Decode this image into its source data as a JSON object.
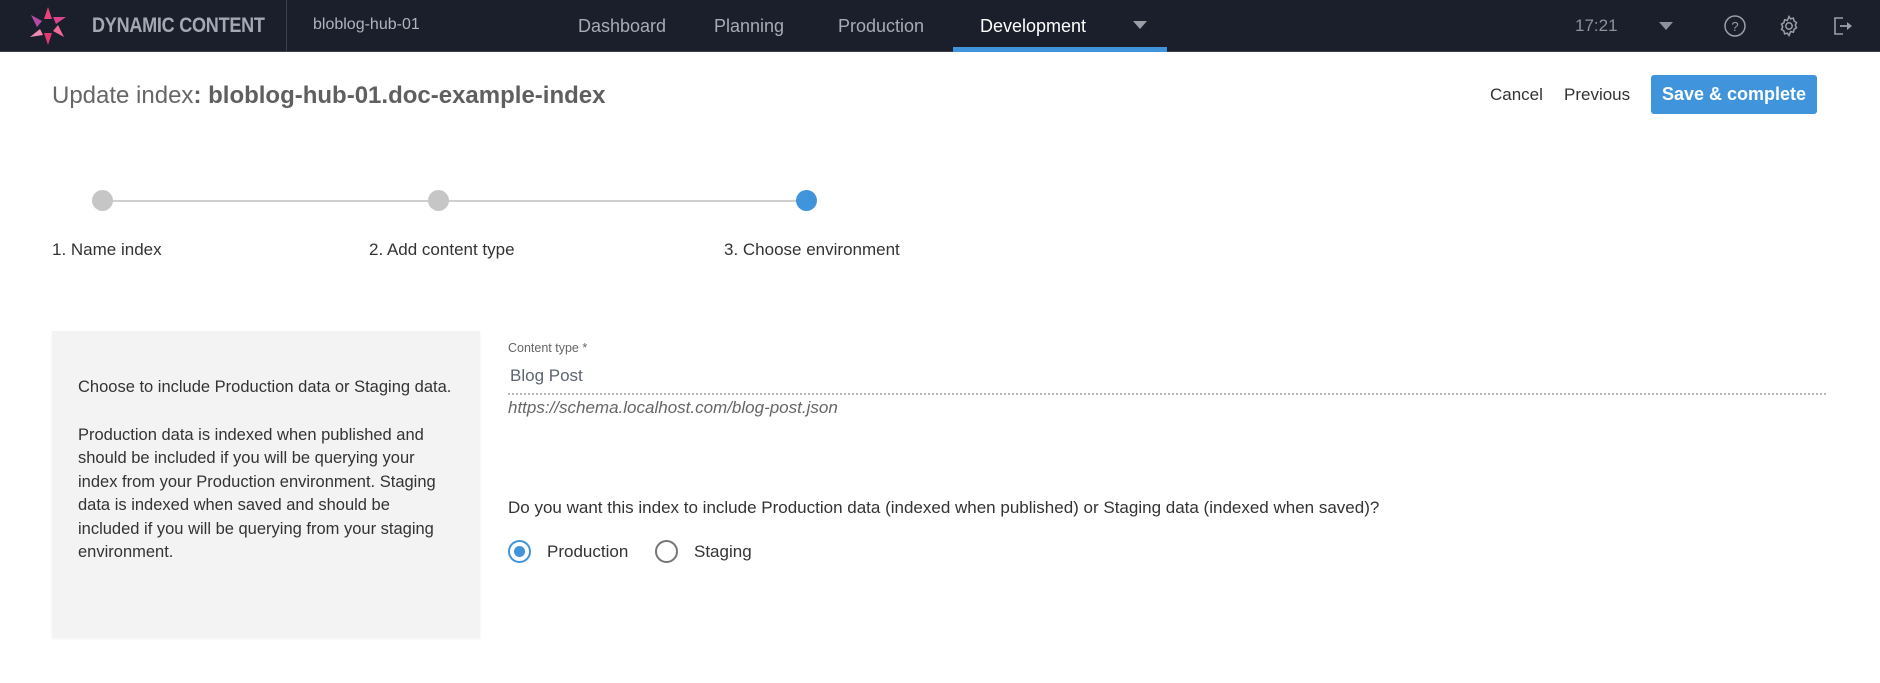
{
  "app": {
    "brand": "DYNAMIC CONTENT",
    "hub_name": "bloblog-hub-01",
    "nav_tabs": [
      {
        "label": "Dashboard",
        "active": false
      },
      {
        "label": "Planning",
        "active": false
      },
      {
        "label": "Production",
        "active": false
      },
      {
        "label": "Development",
        "active": true
      }
    ],
    "clock": "17:21",
    "icons": [
      "help-icon",
      "settings-icon",
      "logout-icon"
    ],
    "accent_color": "#3f94db"
  },
  "header": {
    "title_prefix": "Update index",
    "title_separator": ": ",
    "title_name": "bloblog-hub-01.doc-example-index",
    "cancel_label": "Cancel",
    "previous_label": "Previous",
    "save_label": "Save & complete"
  },
  "stepper": {
    "steps": [
      {
        "label": "1. Name index",
        "state": "complete"
      },
      {
        "label": "2. Add content type",
        "state": "complete"
      },
      {
        "label": "3. Choose environment",
        "state": "active"
      }
    ]
  },
  "info_panel": {
    "paragraphs": [
      "Choose to include Production data or Staging data.",
      "Production data is indexed when published and should be included if you will be querying your index from your Production environment. Staging data is indexed when saved and should be included if you will be querying from your staging environment."
    ]
  },
  "form": {
    "content_type": {
      "label": "Content type *",
      "value": "Blog Post",
      "schema_url": "https://schema.localhost.com/blog-post.json"
    },
    "environment": {
      "question": "Do you want this index to include Production data (indexed when published) or Staging data (indexed when saved)?",
      "options": [
        {
          "label": "Production",
          "checked": true
        },
        {
          "label": "Staging",
          "checked": false
        }
      ]
    }
  }
}
